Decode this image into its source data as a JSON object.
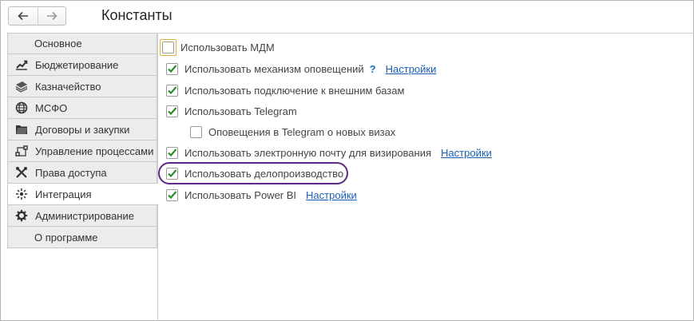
{
  "window": {
    "title": "Константы"
  },
  "nav": {
    "back_icon": "arrow-left-icon",
    "forward_icon": "arrow-right-icon"
  },
  "sidebar": {
    "items": [
      {
        "label": "Основное",
        "icon": ""
      },
      {
        "label": "Бюджетирование",
        "icon": "chart-icon"
      },
      {
        "label": "Казначейство",
        "icon": "money-icon"
      },
      {
        "label": "МСФО",
        "icon": "globe-icon"
      },
      {
        "label": "Договоры и закупки",
        "icon": "folder-icon"
      },
      {
        "label": "Управление процессами",
        "icon": "process-icon"
      },
      {
        "label": "Права доступа",
        "icon": "tools-icon"
      },
      {
        "label": "Интеграция",
        "icon": "integration-icon",
        "active": true
      },
      {
        "label": "Администрирование",
        "icon": "gear-icon"
      },
      {
        "label": "О программе",
        "icon": ""
      }
    ]
  },
  "settings": {
    "mdm": {
      "label": "Использовать МДМ",
      "checked": false
    },
    "notifications": {
      "label": "Использовать механизм оповещений",
      "help": "?",
      "link": "Настройки",
      "checked": true
    },
    "external_db": {
      "label": "Использовать подключение к внешним базам",
      "checked": true
    },
    "telegram": {
      "label": "Использовать Telegram",
      "checked": true
    },
    "telegram_visas": {
      "label": "Оповещения в Telegram о новых визах",
      "checked": false
    },
    "email_visas": {
      "label": "Использовать электронную почту для визирования",
      "link": "Настройки",
      "checked": true
    },
    "records": {
      "label": "Использовать делопроизводство",
      "checked": true
    },
    "powerbi": {
      "label": "Использовать Power BI",
      "link": "Настройки",
      "checked": true
    }
  },
  "colors": {
    "check": "#2e8b2e",
    "link": "#1a5fb4",
    "highlight": "#5b2a86",
    "focus": "#e3b13d"
  }
}
